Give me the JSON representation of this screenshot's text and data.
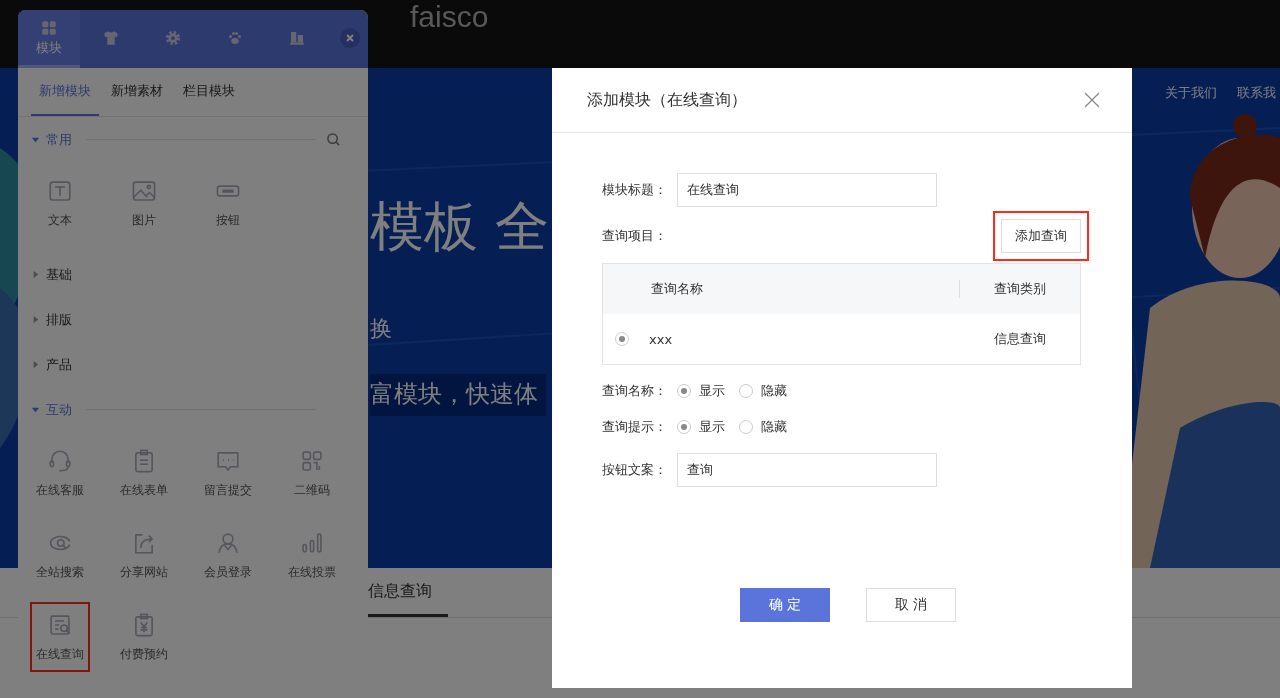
{
  "page": {
    "logo": "faisco",
    "nav": [
      "关于我们",
      "联系我"
    ],
    "banner": {
      "kind": "picture",
      "headline": "模板 全",
      "subline": "换",
      "tagline": "富模块，快速体"
    },
    "tabs": [
      {
        "label": "信息查询",
        "selected": true
      }
    ]
  },
  "panel": {
    "top_tabs": [
      {
        "label": "模块",
        "selected": true
      },
      {
        "selected": false
      },
      {
        "selected": false
      },
      {
        "selected": false
      },
      {
        "selected": false
      }
    ],
    "sub_tabs": [
      {
        "label": "新增模块",
        "selected": true
      },
      {
        "label": "新增素材",
        "selected": false
      },
      {
        "label": "栏目模块",
        "selected": false
      }
    ],
    "categories": [
      {
        "name": "常用",
        "expanded": true,
        "items": [
          {
            "label": "文本",
            "highlighted": false
          },
          {
            "label": "图片",
            "highlighted": false
          },
          {
            "label": "按钮",
            "highlighted": false
          }
        ]
      },
      {
        "name": "基础",
        "expanded": false
      },
      {
        "name": "排版",
        "expanded": false
      },
      {
        "name": "产品",
        "expanded": false
      },
      {
        "name": "互动",
        "expanded": true,
        "items": [
          {
            "label": "在线客服",
            "highlighted": false
          },
          {
            "label": "在线表单",
            "highlighted": false
          },
          {
            "label": "留言提交",
            "highlighted": false
          },
          {
            "label": "二维码",
            "highlighted": false
          },
          {
            "label": "全站搜索",
            "highlighted": false
          },
          {
            "label": "分享网站",
            "highlighted": false
          },
          {
            "label": "会员登录",
            "highlighted": false
          },
          {
            "label": "在线投票",
            "highlighted": false
          },
          {
            "label": "在线查询",
            "highlighted": true
          },
          {
            "label": "付费预约",
            "highlighted": false
          }
        ]
      }
    ]
  },
  "dialog": {
    "title": "添加模块（在线查询）",
    "module_title": {
      "label": "模块标题：",
      "value": "在线查询"
    },
    "query_items": {
      "label": "查询项目：",
      "add_button": {
        "label": "添加查询",
        "highlighted": true
      },
      "columns": [
        "查询名称",
        "查询类别"
      ],
      "rows": [
        {
          "selected": true,
          "name": "xxx",
          "category": "信息查询"
        }
      ]
    },
    "radio_groups": [
      {
        "label": "查询名称：",
        "options": [
          {
            "label": "显示",
            "selected": true
          },
          {
            "label": "隐藏",
            "selected": false
          }
        ]
      },
      {
        "label": "查询提示：",
        "options": [
          {
            "label": "显示",
            "selected": true
          },
          {
            "label": "隐藏",
            "selected": false
          }
        ]
      }
    ],
    "button_text": {
      "label": "按钮文案：",
      "value": "查询"
    },
    "buttons": [
      {
        "label": "确 定",
        "kind": "primary"
      },
      {
        "label": "取 消",
        "kind": "default"
      }
    ]
  }
}
